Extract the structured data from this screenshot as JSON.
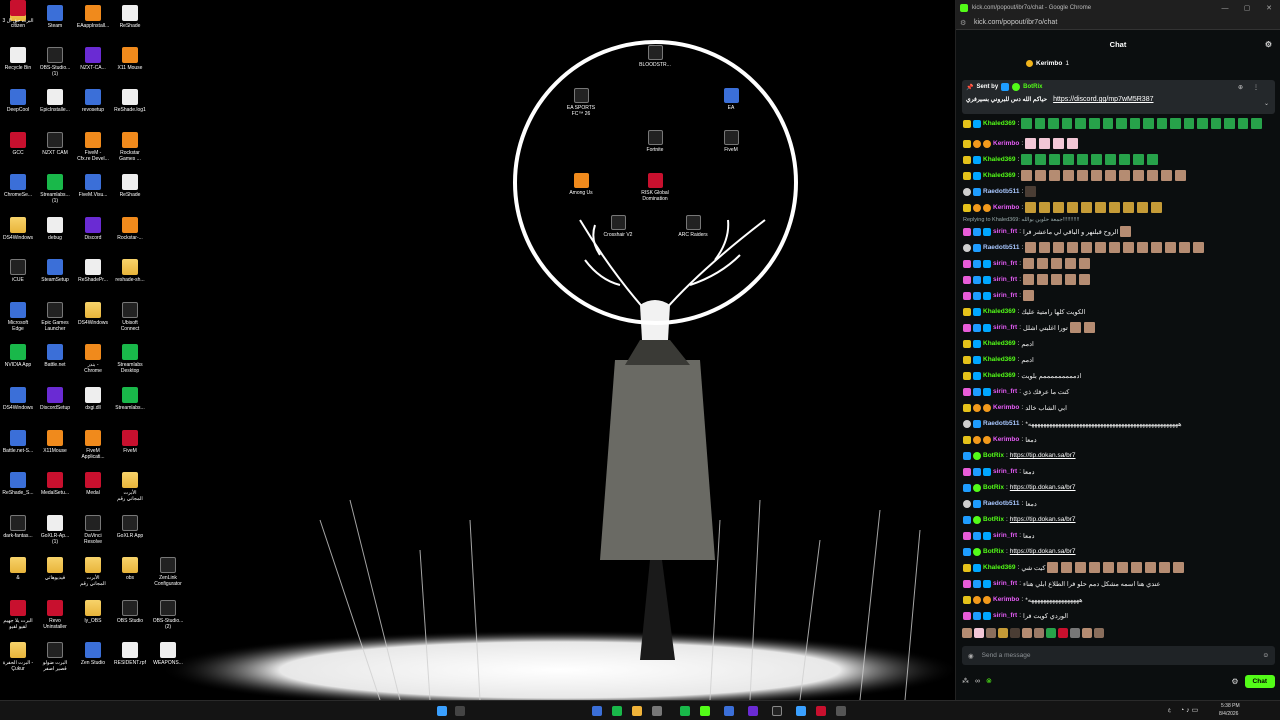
{
  "desktop": {
    "icons": [
      {
        "label": "citizen",
        "kind": "folder"
      },
      {
        "label": "Steam",
        "kind": "app"
      },
      {
        "label": "EAappInstall...",
        "kind": "orange"
      },
      {
        "label": "ReShade",
        "kind": "file"
      },
      {
        "label": "Recycle Bin",
        "kind": "file"
      },
      {
        "label": "OBS-Studio...\n(1)",
        "kind": "dark"
      },
      {
        "label": "NZXT-CA...",
        "kind": "purple"
      },
      {
        "label": "X11 Mouse",
        "kind": "orange"
      },
      {
        "label": "DeepCool",
        "kind": "app"
      },
      {
        "label": "EpicInstalle...",
        "kind": "file"
      },
      {
        "label": "revosetup",
        "kind": "app"
      },
      {
        "label": "ReShade.log1",
        "kind": "file"
      },
      {
        "label": "GCC",
        "kind": "red"
      },
      {
        "label": "NZXT CAM",
        "kind": "dark"
      },
      {
        "label": "FiveM -\nCfx.re Devel...",
        "kind": "orange"
      },
      {
        "label": "Rockstar\nGames ...",
        "kind": "orange"
      },
      {
        "label": "ChromeSe...",
        "kind": "app"
      },
      {
        "label": "Streamlabs...\n(1)",
        "kind": "green"
      },
      {
        "label": "FiveM.Visu...",
        "kind": "app"
      },
      {
        "label": "ReShade",
        "kind": "file"
      },
      {
        "label": "DS4Windows",
        "kind": "folder"
      },
      {
        "label": "debug",
        "kind": "file"
      },
      {
        "label": "Discord",
        "kind": "purple"
      },
      {
        "label": "Rockstar-...",
        "kind": "orange"
      },
      {
        "label": "iCUE",
        "kind": "dark"
      },
      {
        "label": "SteamSetup",
        "kind": "app"
      },
      {
        "label": "ReShadePr...",
        "kind": "file"
      },
      {
        "label": "reshade-sh...",
        "kind": "folder"
      },
      {
        "label": "Microsoft\nEdge",
        "kind": "app"
      },
      {
        "label": "Epic Games\nLauncher",
        "kind": "dark"
      },
      {
        "label": "DS4Windows",
        "kind": "folder"
      },
      {
        "label": "Ubisoft\nConnect",
        "kind": "dark"
      },
      {
        "label": "NVIDIA App",
        "kind": "green"
      },
      {
        "label": "Battle.net",
        "kind": "app"
      },
      {
        "label": "بندر -\nChrome",
        "kind": "orange"
      },
      {
        "label": "Streamlabs\nDesktop",
        "kind": "green"
      },
      {
        "label": "DS4Windows",
        "kind": "app"
      },
      {
        "label": "DiscordSetup",
        "kind": "purple"
      },
      {
        "label": "dxgi.dll",
        "kind": "file"
      },
      {
        "label": "Streamlabs...",
        "kind": "green"
      },
      {
        "label": "Battle.net-S...",
        "kind": "app"
      },
      {
        "label": "X11Mouse",
        "kind": "orange"
      },
      {
        "label": "FiveM\nApplicati...",
        "kind": "orange"
      },
      {
        "label": "FiveM",
        "kind": "red"
      },
      {
        "label": "ReShade_S...",
        "kind": "app"
      },
      {
        "label": "MedalSetu...",
        "kind": "red"
      },
      {
        "label": "Medal",
        "kind": "red"
      },
      {
        "label": "الأبرت\nالمجاني رقم",
        "kind": "folder"
      },
      {
        "label": "dark-fantas...",
        "kind": "dark"
      },
      {
        "label": "GoXLR-Ap...\n(1)",
        "kind": "file"
      },
      {
        "label": "DaVinci\nResolve",
        "kind": "dark"
      },
      {
        "label": "GoXLR App",
        "kind": "dark"
      },
      {
        "label": "&",
        "kind": "folder"
      },
      {
        "label": "فيديوهاتي",
        "kind": "folder"
      },
      {
        "label": "الأبرت\nالمجاني رقم",
        "kind": "folder"
      },
      {
        "label": "obs",
        "kind": "folder"
      },
      {
        "label": "ZenLink\nConfigurator",
        "kind": "dark"
      },
      {
        "label": "البرت يلا جهيم\nلقيو لقيو",
        "kind": "red"
      },
      {
        "label": "Revo\nUninstaller",
        "kind": "red"
      },
      {
        "label": "ly_OBS",
        "kind": "folder"
      },
      {
        "label": "OBS Studio",
        "kind": "dark"
      },
      {
        "label": "OBS-Studio...\n(2)",
        "kind": "dark"
      },
      {
        "label": "البرت الحفرة -\nÇukur",
        "kind": "folder"
      },
      {
        "label": "البرت ضولو\nقصير اصفر",
        "kind": "dark"
      },
      {
        "label": "Zen Studio",
        "kind": "app"
      },
      {
        "label": "RESIDENT.rpf",
        "kind": "file"
      },
      {
        "label": "WEAPONS...",
        "kind": "file"
      },
      {
        "label": "البرت حق ال 3",
        "kind": "red"
      }
    ],
    "ring_icons": [
      {
        "label": "BLOODSTR...",
        "kind": "dark"
      },
      {
        "label": "EA SPORTS\nFC™ 26",
        "kind": "dark"
      },
      {
        "label": "EA",
        "kind": "app"
      },
      {
        "label": "Fortnite",
        "kind": "dark"
      },
      {
        "label": "FiveM",
        "kind": "dark"
      },
      {
        "label": "Among Us",
        "kind": "orange"
      },
      {
        "label": "RISK Global\nDomination",
        "kind": "red"
      },
      {
        "label": "Crosshair V2",
        "kind": "dark"
      },
      {
        "label": "ARC Raiders",
        "kind": "dark"
      }
    ]
  },
  "taskbar": {
    "time": "5:38 PM",
    "date": "8/4/2026",
    "lang": "ع"
  },
  "chrome": {
    "window_title": "kick.com/popout/ibr7o/chat - Google Chrome",
    "url": "kick.com/popout/ibr7o/chat"
  },
  "chat": {
    "header": "Chat",
    "top_gifter": {
      "name": "Kerimbo",
      "count": "1"
    },
    "pinned": {
      "sent_by_label": "Sent by",
      "bot_name": "BotRix",
      "message": "حياكم الله دس للبروني بسيرفري",
      "link": "https://discord.gg/mp7wM5R387"
    },
    "reply_to": "Replying to Khaled369: جمعة حلوين بوالله!!!!!!!!!!!",
    "messages": [
      {
        "badges": [
          "sub",
          "mod"
        ],
        "user": "Khaled369",
        "color": "#53fc18",
        "text": "",
        "emotes": "green",
        "count": 18
      },
      {
        "badges": [
          "sub",
          "gift",
          "gift"
        ],
        "user": "Kerimbo",
        "color": "#e65cf7",
        "text": "",
        "emotes": "pink",
        "count": 4
      },
      {
        "badges": [
          "sub",
          "mod"
        ],
        "user": "Khaled369",
        "color": "#53fc18",
        "text": "",
        "emotes": "green",
        "count": 10
      },
      {
        "badges": [
          "sub",
          "mod"
        ],
        "user": "Khaled369",
        "color": "#53fc18",
        "text": "",
        "emotes": "face",
        "count": 12
      },
      {
        "badges": [
          "og",
          "verified"
        ],
        "user": "Raedotb511",
        "color": "#a8c7ff",
        "text": "",
        "emotes": "dark",
        "count": 1
      },
      {
        "badges": [
          "sub",
          "gift",
          "gift"
        ],
        "user": "Kerimbo",
        "color": "#e65cf7",
        "text": "",
        "emotes": "banana",
        "count": 10
      },
      {
        "badges": [
          "vip",
          "verified",
          "mod"
        ],
        "user": "sirin_frt",
        "color": "#e65cf7",
        "text": "الروح قبلنهر و الباقي لي ماعشر فرا",
        "emotes": "face",
        "count": 1
      },
      {
        "badges": [
          "og",
          "verified"
        ],
        "user": "Raedotb511",
        "color": "#a8c7ff",
        "text": "",
        "emotes": "face",
        "count": 13
      },
      {
        "badges": [
          "vip",
          "verified",
          "mod"
        ],
        "user": "sirin_frt",
        "color": "#e65cf7",
        "text": "",
        "emotes": "face",
        "count": 5
      },
      {
        "badges": [
          "vip",
          "verified",
          "mod"
        ],
        "user": "sirin_frt",
        "color": "#e65cf7",
        "text": "",
        "emotes": "face",
        "count": 5
      },
      {
        "badges": [
          "vip",
          "verified",
          "mod"
        ],
        "user": "sirin_frt",
        "color": "#e65cf7",
        "text": "",
        "emotes": "face",
        "count": 1
      },
      {
        "badges": [
          "sub",
          "mod"
        ],
        "user": "Khaled369",
        "color": "#53fc18",
        "text": "الكويت كلها رامتية عليك",
        "emotes": "",
        "count": 0
      },
      {
        "badges": [
          "vip",
          "verified",
          "mod"
        ],
        "user": "sirin_frt",
        "color": "#e65cf7",
        "text": "تورا اغلبتي اشلل",
        "emotes": "face",
        "count": 2
      },
      {
        "badges": [
          "sub",
          "mod"
        ],
        "user": "Khaled369",
        "color": "#53fc18",
        "text": "ادمم",
        "emotes": "",
        "count": 0
      },
      {
        "badges": [
          "sub",
          "mod"
        ],
        "user": "Khaled369",
        "color": "#53fc18",
        "text": "ادمم",
        "emotes": "",
        "count": 0
      },
      {
        "badges": [
          "sub",
          "mod"
        ],
        "user": "Khaled369",
        "color": "#53fc18",
        "text": "ادمممممممممم بلويت",
        "emotes": "",
        "count": 0
      },
      {
        "badges": [
          "vip",
          "verified",
          "mod"
        ],
        "user": "sirin_frt",
        "color": "#e65cf7",
        "text": "كنت ما عرفك ذي",
        "emotes": "",
        "count": 0
      },
      {
        "badges": [
          "sub",
          "gift",
          "gift"
        ],
        "user": "Kerimbo",
        "color": "#e65cf7",
        "text": "ابي الشاب خالد",
        "emotes": "",
        "count": 0
      },
      {
        "badges": [
          "og",
          "verified"
        ],
        "user": "Raedotb511",
        "color": "#a8c7ff",
        "text": "*ههههههههههههههههههههههههههههههههههههههههههههههههههه",
        "emotes": "",
        "count": 0
      },
      {
        "badges": [
          "sub",
          "gift",
          "gift"
        ],
        "user": "Kerimbo",
        "color": "#e65cf7",
        "text": "دمعا",
        "emotes": "",
        "count": 0
      },
      {
        "badges": [
          "verified",
          "bot"
        ],
        "user": "BotRix",
        "color": "#53fc18",
        "text": "",
        "link": "https://tip.dokan.sa/br7",
        "emotes": "",
        "count": 0
      },
      {
        "badges": [
          "vip",
          "verified",
          "mod"
        ],
        "user": "sirin_frt",
        "color": "#e65cf7",
        "text": "دمعا",
        "emotes": "",
        "count": 0
      },
      {
        "badges": [
          "verified",
          "bot"
        ],
        "user": "BotRix",
        "color": "#53fc18",
        "text": "",
        "link": "https://tip.dokan.sa/br7",
        "emotes": "",
        "count": 0
      },
      {
        "badges": [
          "og",
          "verified"
        ],
        "user": "Raedotb511",
        "color": "#a8c7ff",
        "text": "دمعا",
        "emotes": "",
        "count": 0
      },
      {
        "badges": [
          "verified",
          "bot"
        ],
        "user": "BotRix",
        "color": "#53fc18",
        "text": "",
        "link": "https://tip.dokan.sa/br7",
        "emotes": "",
        "count": 0
      },
      {
        "badges": [
          "vip",
          "verified",
          "mod"
        ],
        "user": "sirin_frt",
        "color": "#e65cf7",
        "text": "دمعا",
        "emotes": "",
        "count": 0
      },
      {
        "badges": [
          "verified",
          "bot"
        ],
        "user": "BotRix",
        "color": "#53fc18",
        "text": "",
        "link": "https://tip.dokan.sa/br7",
        "emotes": "",
        "count": 0
      },
      {
        "badges": [
          "sub",
          "mod"
        ],
        "user": "Khaled369",
        "color": "#53fc18",
        "text": "كيت شي",
        "emotes": "face",
        "count": 10
      },
      {
        "badges": [
          "vip",
          "verified",
          "mod"
        ],
        "user": "sirin_frt",
        "color": "#e65cf7",
        "text": "عندي هنا اسمه مشكل دمم حلو فرا الطلاع ابلي هناء",
        "emotes": "",
        "count": 0
      },
      {
        "badges": [
          "sub",
          "gift",
          "gift"
        ],
        "user": "Kerimbo",
        "color": "#e65cf7",
        "text": "*هههههههههههههههههه",
        "emotes": "",
        "count": 0
      },
      {
        "badges": [
          "vip",
          "verified",
          "mod"
        ],
        "user": "sirin_frt",
        "color": "#e65cf7",
        "text": "الوردي كويت فرا",
        "emotes": "",
        "count": 0
      }
    ],
    "input_placeholder": "Send a message",
    "send_label": "Chat"
  }
}
